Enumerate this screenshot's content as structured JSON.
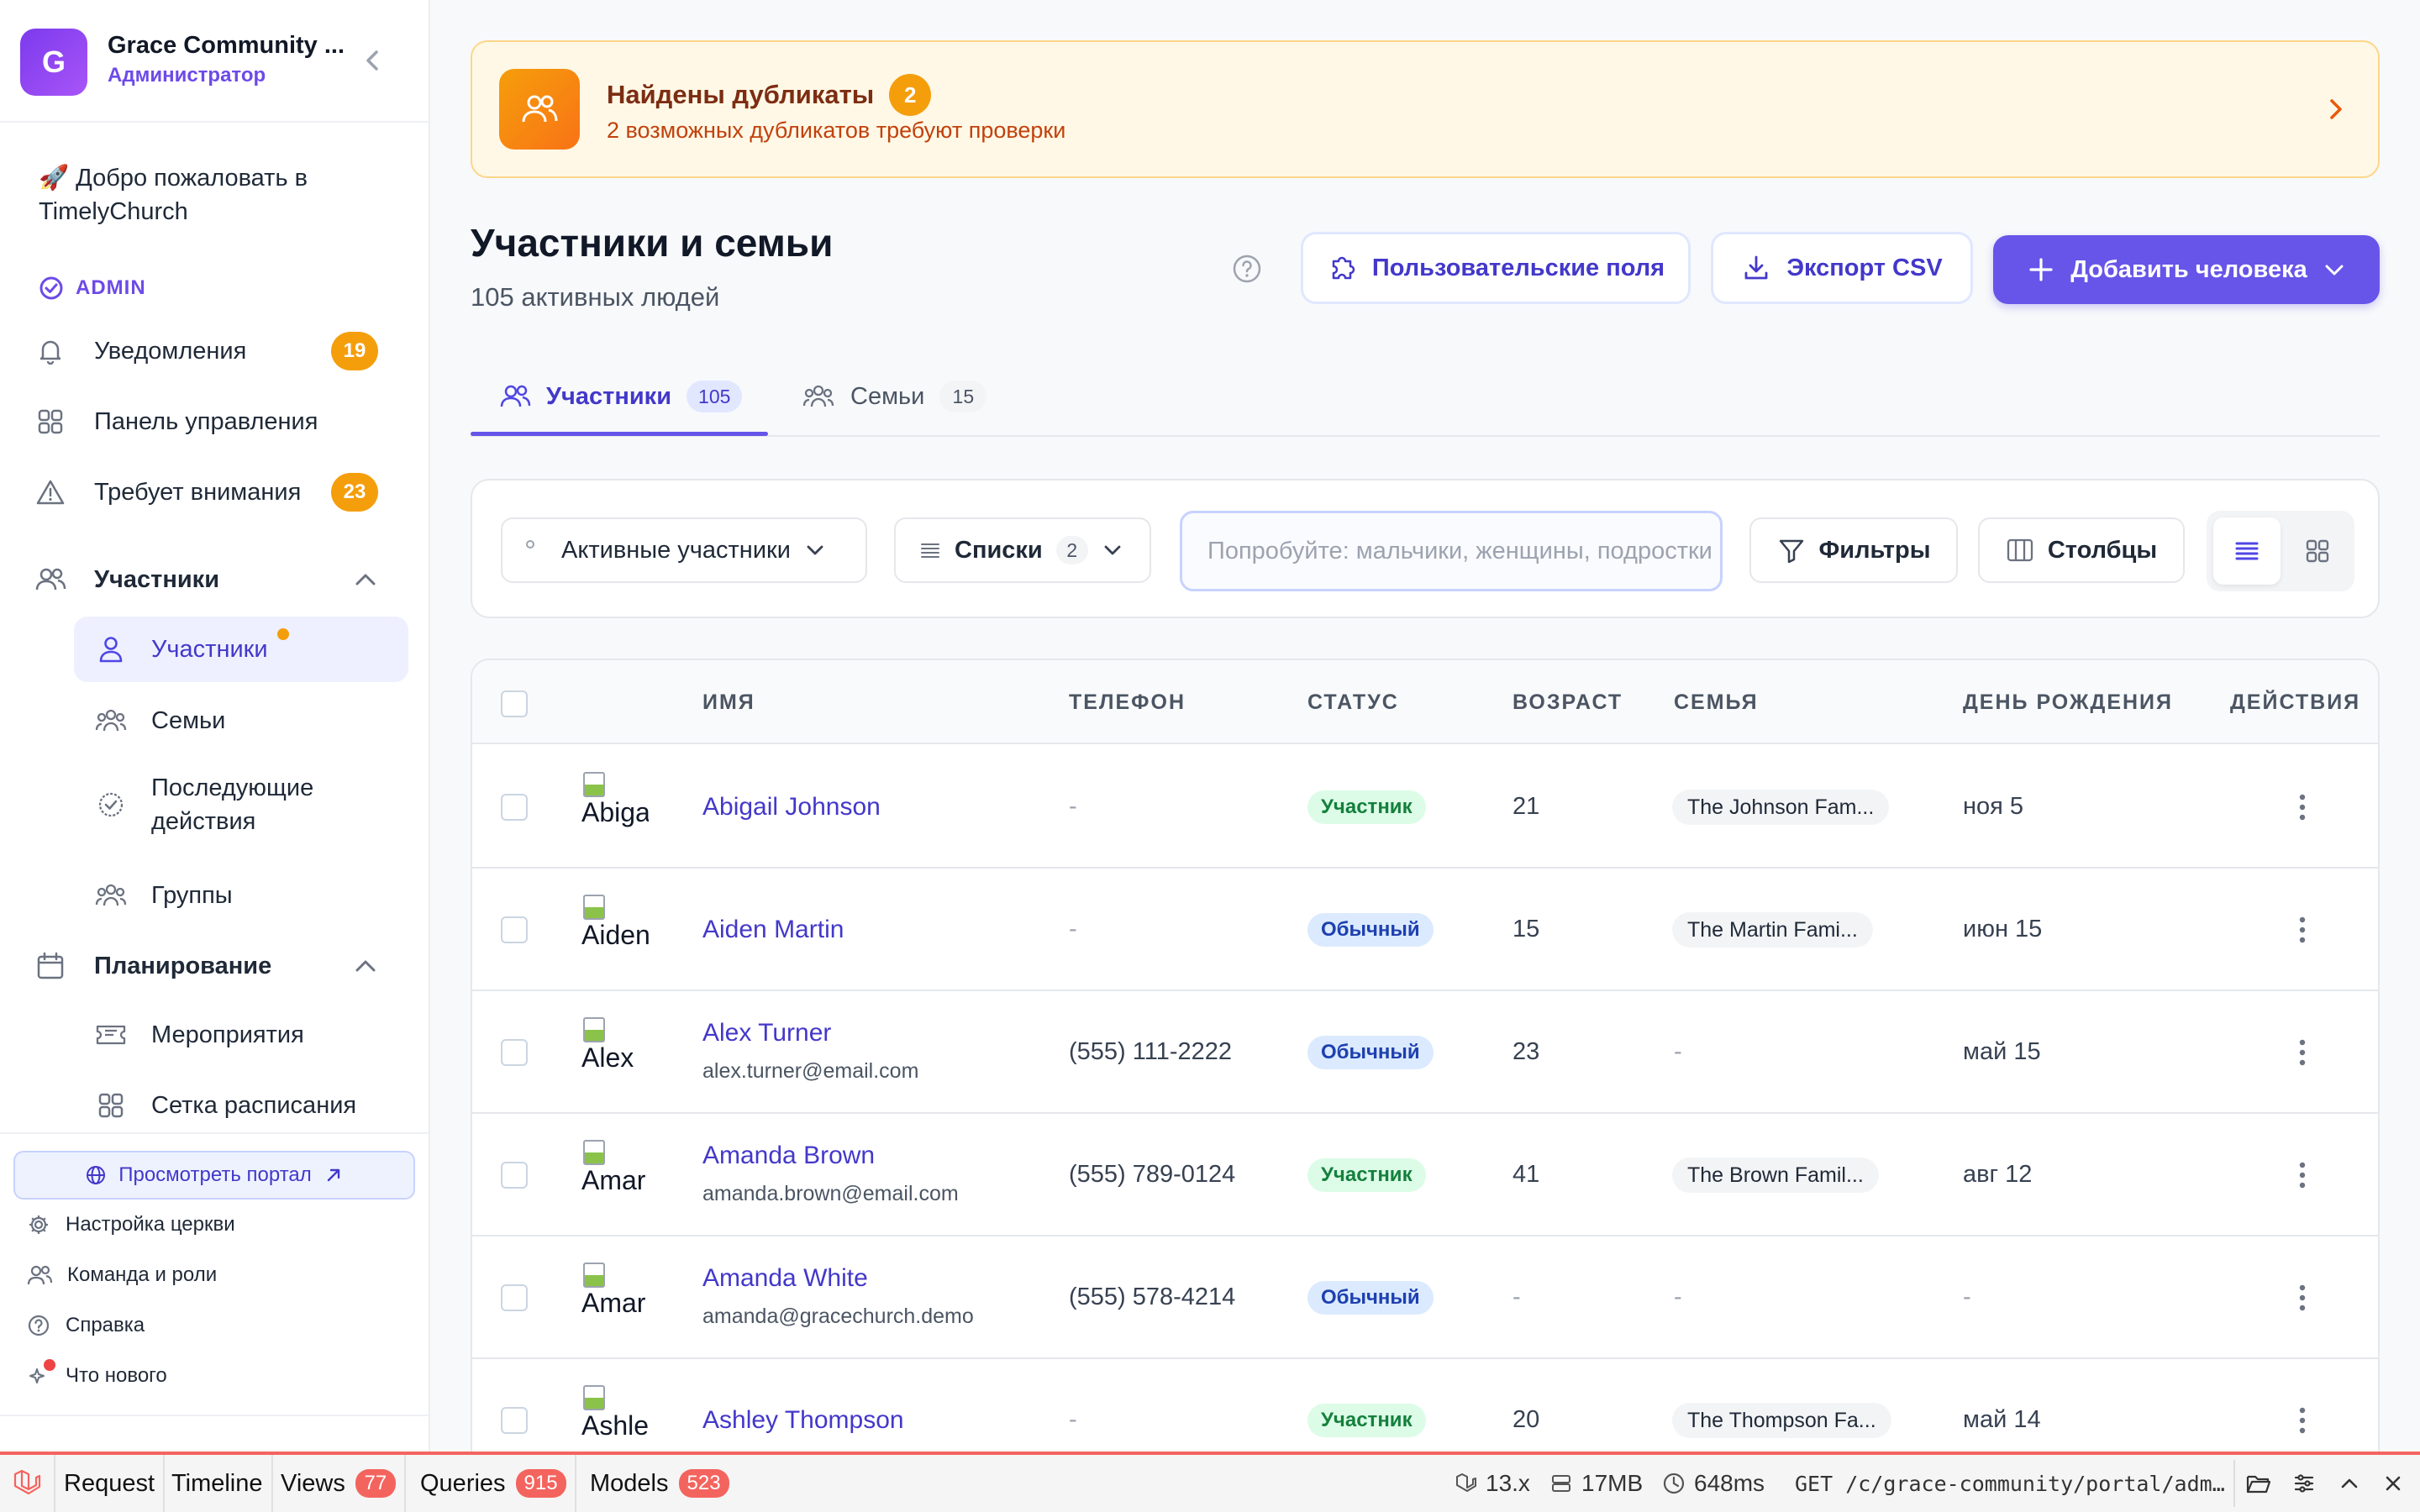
{
  "org": {
    "initial": "G",
    "name": "Grace Community ...",
    "role": "Администратор"
  },
  "sidebar": {
    "welcome": "🚀 Добро пожаловать в TimelyChurch",
    "role_badge": "ADMIN",
    "items": [
      {
        "label": "Уведомления",
        "badge": "19",
        "icon": "bell-icon"
      },
      {
        "label": "Панель управления",
        "icon": "grid-icon"
      },
      {
        "label": "Требует внимания",
        "badge": "23",
        "icon": "warning-icon"
      }
    ],
    "members_section": {
      "label": "Участники",
      "icon": "users-icon",
      "children": [
        {
          "label": "Участники",
          "icon": "user-icon",
          "active": true
        },
        {
          "label": "Семьи",
          "icon": "family-icon"
        },
        {
          "label": "Последующие действия",
          "icon": "check-circle-icon"
        },
        {
          "label": "Группы",
          "icon": "group-icon"
        }
      ]
    },
    "planning_section": {
      "label": "Планирование",
      "icon": "calendar-icon",
      "children": [
        {
          "label": "Мероприятия",
          "icon": "ticket-icon"
        },
        {
          "label": "Сетка расписания",
          "icon": "grid-icon"
        }
      ]
    },
    "portal_button": "Просмотреть портал",
    "footer": [
      "Настройка церкви",
      "Команда и роли",
      "Справка",
      "Что нового"
    ]
  },
  "banner": {
    "title": "Найдены дубликаты",
    "count": "2",
    "subtitle": "2 возможных дубликатов требуют проверки"
  },
  "header": {
    "title": "Участники и семьи",
    "subtitle": "105 активных людей",
    "custom_fields": "Пользовательские поля",
    "export": "Экспорт CSV",
    "add_person": "Добавить человека"
  },
  "tabs": [
    {
      "label": "Участники",
      "count": "105",
      "active": true
    },
    {
      "label": "Семьи",
      "count": "15"
    }
  ],
  "filters": {
    "segment": "Активные участники",
    "lists_label": "Списки",
    "lists_count": "2",
    "search_placeholder": "Попробуйте: мальчики, женщины, подростки",
    "filters_btn": "Фильтры",
    "columns_btn": "Столбцы"
  },
  "table": {
    "columns": [
      "ИМЯ",
      "ТЕЛЕФОН",
      "СТАТУС",
      "ВОЗРАСТ",
      "СЕМЬЯ",
      "ДЕНЬ РОЖДЕНИЯ",
      "ДЕЙСТВИЯ"
    ],
    "rows": [
      {
        "avatar": "Abiga",
        "name": "Abigail Johnson",
        "email": "",
        "phone": "-",
        "status": "Участник",
        "status_type": "member",
        "age": "21",
        "family": "The Johnson Fam...",
        "birthday": "ноя 5"
      },
      {
        "avatar": "Aiden",
        "name": "Aiden Martin",
        "email": "",
        "phone": "-",
        "status": "Обычный",
        "status_type": "regular",
        "age": "15",
        "family": "The Martin Fami...",
        "birthday": "июн 15"
      },
      {
        "avatar": "Alex",
        "name": "Alex Turner",
        "email": "alex.turner@email.com",
        "phone": "(555) 111-2222",
        "status": "Обычный",
        "status_type": "regular",
        "age": "23",
        "family": "-",
        "birthday": "май 15"
      },
      {
        "avatar": "Amar",
        "name": "Amanda Brown",
        "email": "amanda.brown@email.com",
        "phone": "(555) 789-0124",
        "status": "Участник",
        "status_type": "member",
        "age": "41",
        "family": "The Brown Famil...",
        "birthday": "авг 12"
      },
      {
        "avatar": "Amar",
        "name": "Amanda White",
        "email": "amanda@gracechurch.demo",
        "phone": "(555) 578-4214",
        "status": "Обычный",
        "status_type": "regular",
        "age": "-",
        "family": "-",
        "birthday": "-"
      },
      {
        "avatar": "Ashle",
        "name": "Ashley Thompson",
        "email": "",
        "phone": "-",
        "status": "Участник",
        "status_type": "member",
        "age": "20",
        "family": "The Thompson Fa...",
        "birthday": "май 14"
      }
    ]
  },
  "debugbar": {
    "request": "Request",
    "timeline": "Timeline",
    "views": "Views",
    "views_count": "77",
    "queries": "Queries",
    "queries_count": "915",
    "models": "Models",
    "models_count": "523",
    "version": "13.x",
    "memory": "17MB",
    "time": "648ms",
    "route": "GET /c/grace-community/portal/adm…"
  },
  "colors": {
    "accent": "#6655e8",
    "warning": "#f59e0b",
    "debug": "#f4645f"
  }
}
